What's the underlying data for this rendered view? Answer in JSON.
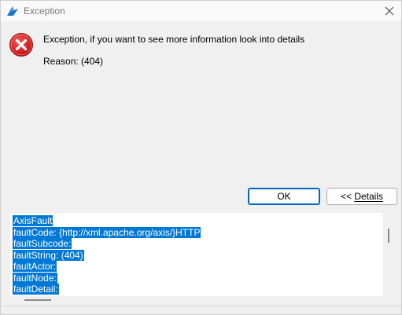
{
  "window": {
    "title": "Exception"
  },
  "dialog": {
    "message": "Exception, if you want to see more information look into details",
    "reason": "Reason: (404)"
  },
  "buttons": {
    "ok_label": "OK",
    "details_prefix": "<< ",
    "details_label": "Details"
  },
  "details": {
    "lines": [
      "AxisFault",
      " faultCode: {http://xml.apache.org/axis/}HTTP",
      " faultSubcode:",
      " faultString: (404)",
      " faultActor:",
      " faultNode:",
      " faultDetail:"
    ]
  },
  "colors": {
    "selection": "#0078d7",
    "error_red": "#e81123",
    "accent": "#0067c0"
  }
}
